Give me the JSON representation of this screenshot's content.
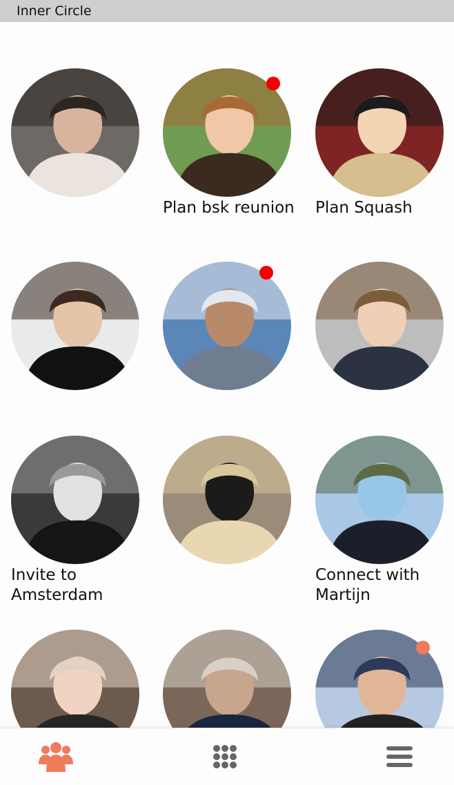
{
  "app": {
    "title": "Inner Circle"
  },
  "colors": {
    "accent": "#f07a5c",
    "badge_red": "#f20000",
    "badge_orange": "#f07a5c",
    "nav_gray": "#666666"
  },
  "contacts": [
    {
      "caption": "",
      "badge": "none",
      "palette": [
        "#6d6a66",
        "#2d2520",
        "#d8b49e",
        "#eae4dd"
      ]
    },
    {
      "caption": "Plan bsk reunion",
      "badge": "red",
      "palette": [
        "#6f9b53",
        "#a86a35",
        "#f0c7a9",
        "#3a2a20"
      ]
    },
    {
      "caption": "Plan Squash",
      "badge": "none",
      "palette": [
        "#7e2424",
        "#1b1b1b",
        "#f3d4b3",
        "#d6be8e"
      ]
    },
    {
      "caption": "",
      "badge": "none",
      "palette": [
        "#e9eaea",
        "#3a2a20",
        "#e6c4a8",
        "#111111"
      ]
    },
    {
      "caption": "",
      "badge": "red",
      "palette": [
        "#5b86b8",
        "#e4e8ee",
        "#b88a6a",
        "#6f7d90"
      ]
    },
    {
      "caption": "",
      "badge": "none",
      "palette": [
        "#bdbdbd",
        "#7b5d3c",
        "#efcfb5",
        "#2b3342"
      ]
    },
    {
      "caption": "Invite to\nAmsterdam",
      "badge": "none",
      "palette": [
        "#3a3a3a",
        "#999999",
        "#e1e1e1",
        "#151515"
      ]
    },
    {
      "caption": "",
      "badge": "none",
      "palette": [
        "#9a8c79",
        "#d8c79b",
        "#1b1b1b",
        "#e9d7b1"
      ]
    },
    {
      "caption": "Connect with\nMartijn",
      "badge": "none",
      "palette": [
        "#a9c8e8",
        "#5d6b45",
        "#97c6e6",
        "#1c1f2a"
      ]
    },
    {
      "caption": "",
      "badge": "none",
      "palette": [
        "#6c5a4c",
        "#e3d1c4",
        "#f1d3c1",
        "#252525"
      ]
    },
    {
      "caption": "",
      "badge": "none",
      "palette": [
        "#7a675a",
        "#d7d0c6",
        "#c8a58d",
        "#19263f"
      ]
    },
    {
      "caption": "",
      "badge": "orange",
      "palette": [
        "#b6c9e0",
        "#2d3a57",
        "#e1b697",
        "#222222"
      ]
    }
  ],
  "bottom_nav": {
    "items": [
      {
        "name": "friends",
        "icon": "people-icon",
        "active": true
      },
      {
        "name": "apps",
        "icon": "grid-dots-icon",
        "active": false
      },
      {
        "name": "menu",
        "icon": "hamburger-icon",
        "active": false
      }
    ]
  }
}
